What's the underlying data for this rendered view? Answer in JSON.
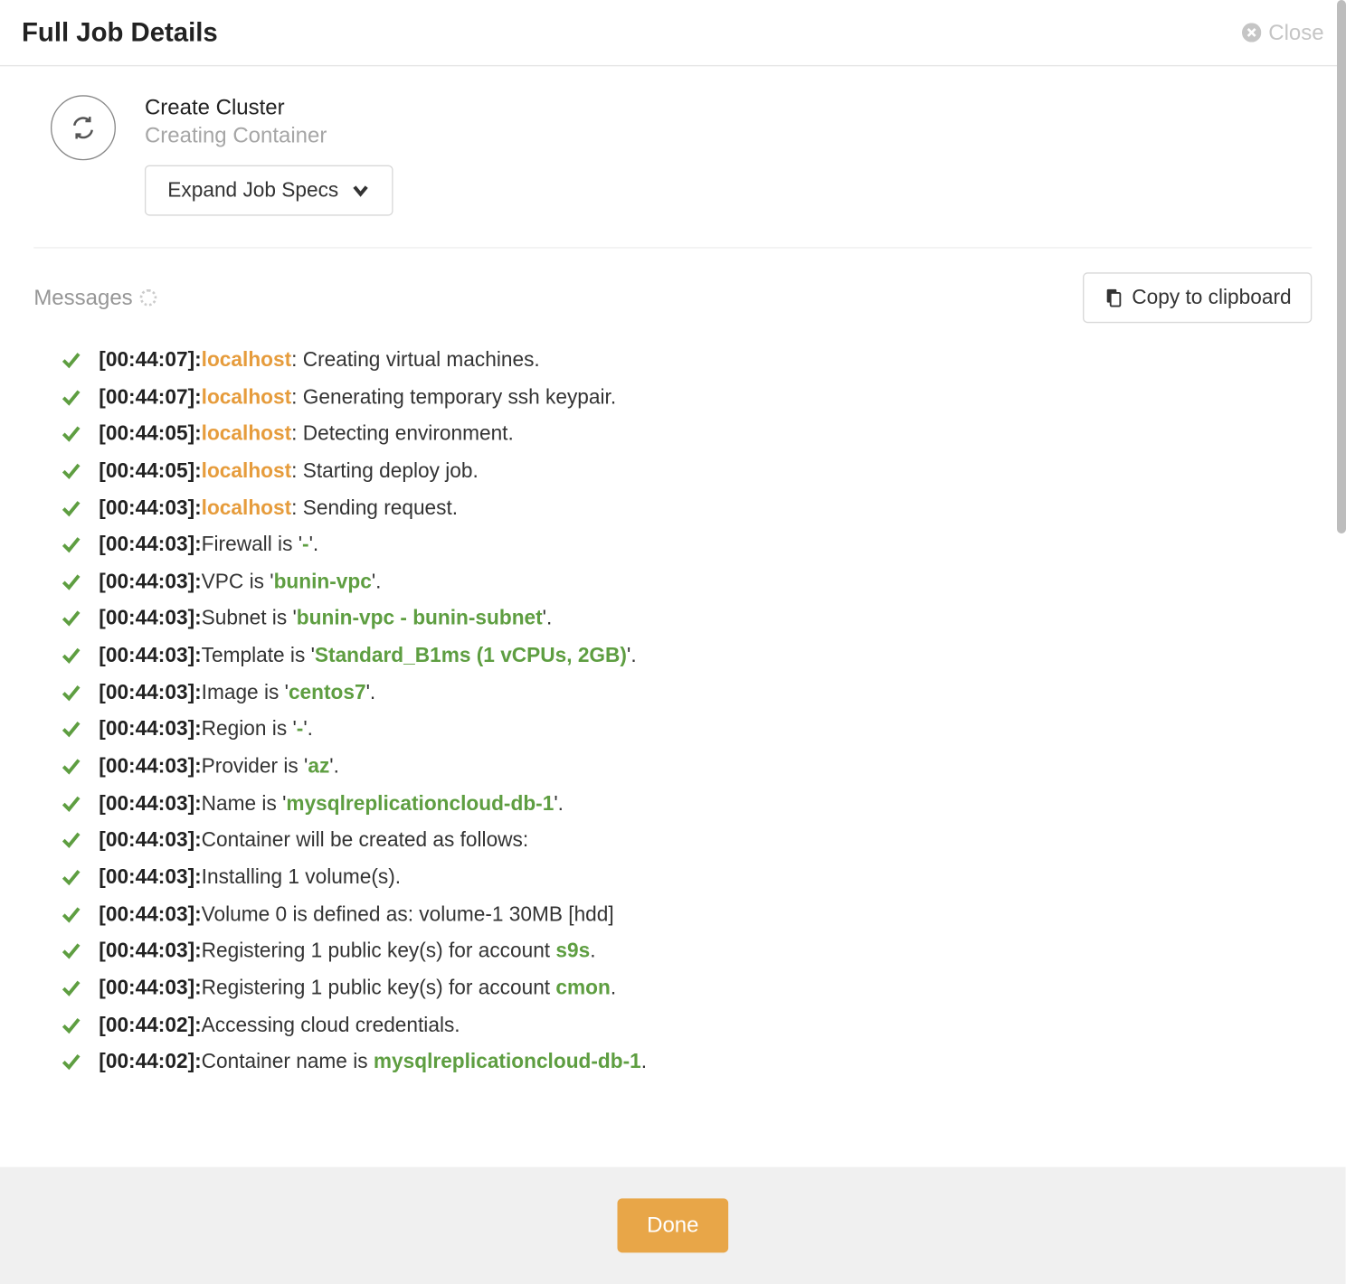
{
  "header": {
    "title": "Full Job Details",
    "close_label": "Close"
  },
  "job": {
    "title": "Create Cluster",
    "subtitle": "Creating Container",
    "expand_label": "Expand Job Specs"
  },
  "messages_label": "Messages",
  "copy_label": "Copy to clipboard",
  "done_label": "Done",
  "logs": [
    {
      "ts": "[00:44:07]:",
      "host": "localhost",
      "pre": ": ",
      "text": "Creating virtual machines."
    },
    {
      "ts": "[00:44:07]:",
      "host": "localhost",
      "pre": ": ",
      "text": "Generating temporary ssh keypair."
    },
    {
      "ts": "[00:44:05]:",
      "host": "localhost",
      "pre": ": ",
      "text": "Detecting environment."
    },
    {
      "ts": "[00:44:05]:",
      "host": "localhost",
      "pre": ": ",
      "text": "Starting deploy job."
    },
    {
      "ts": "[00:44:03]:",
      "host": "localhost",
      "pre": ": ",
      "text": "Sending request."
    },
    {
      "ts": "[00:44:03]:",
      "text_pre": "Firewall is '",
      "val": "-",
      "text_post": "'."
    },
    {
      "ts": "[00:44:03]:",
      "text_pre": "VPC is '",
      "val": "bunin-vpc",
      "text_post": "'."
    },
    {
      "ts": "[00:44:03]:",
      "text_pre": "Subnet is '",
      "val": "bunin-vpc - bunin-subnet",
      "text_post": "'."
    },
    {
      "ts": "[00:44:03]:",
      "text_pre": "Template is '",
      "val": "Standard_B1ms (1 vCPUs, 2GB)",
      "text_post": "'."
    },
    {
      "ts": "[00:44:03]:",
      "text_pre": "Image is '",
      "val": "centos7",
      "text_post": "'."
    },
    {
      "ts": "[00:44:03]:",
      "text_pre": "Region is '",
      "val": "-",
      "text_post": "'."
    },
    {
      "ts": "[00:44:03]:",
      "text_pre": "Provider is '",
      "val": "az",
      "text_post": "'."
    },
    {
      "ts": "[00:44:03]:",
      "text_pre": "Name is '",
      "val": "mysqlreplicationcloud-db-1",
      "text_post": "'."
    },
    {
      "ts": "[00:44:03]:",
      "text": "Container will be created as follows:"
    },
    {
      "ts": "[00:44:03]:",
      "text": "Installing 1 volume(s)."
    },
    {
      "ts": "[00:44:03]:",
      "text": "Volume 0 is defined as: volume-1 30MB [hdd]"
    },
    {
      "ts": "[00:44:03]:",
      "text_pre": "Registering 1 public key(s) for account ",
      "val": "s9s",
      "text_post": "."
    },
    {
      "ts": "[00:44:03]:",
      "text_pre": "Registering 1 public key(s) for account ",
      "val": "cmon",
      "text_post": "."
    },
    {
      "ts": "[00:44:02]:",
      "text": "Accessing cloud credentials."
    },
    {
      "ts": "[00:44:02]:",
      "text_pre": "Container name is ",
      "val": "mysqlreplicationcloud-db-1",
      "text_post": "."
    }
  ]
}
